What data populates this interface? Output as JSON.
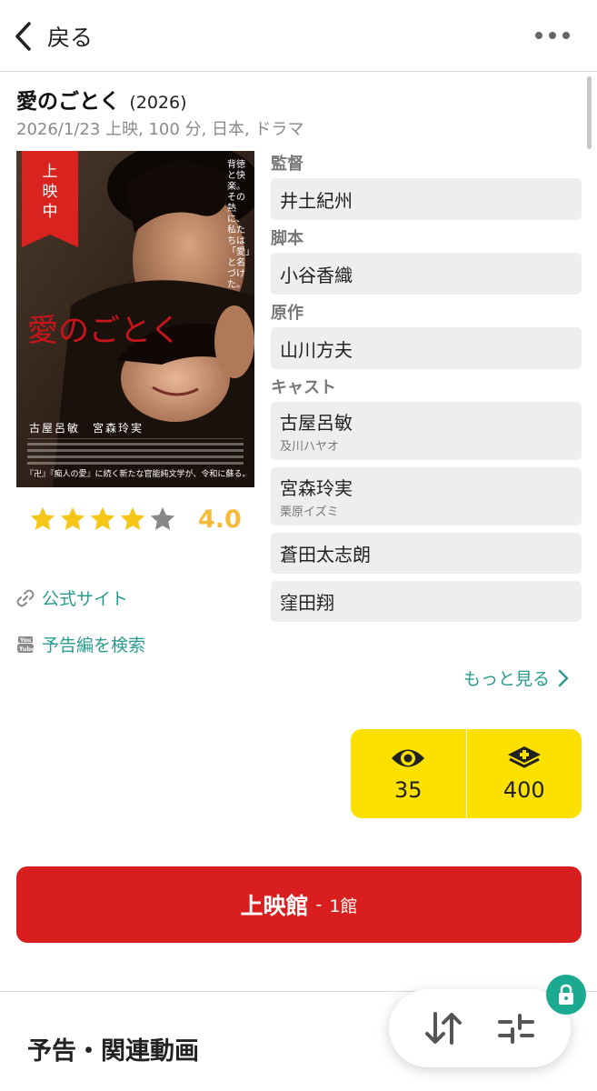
{
  "header": {
    "back_label": "戻る"
  },
  "movie": {
    "title": "愛のごとく",
    "year": "(2026)",
    "meta": "2026/1/23 上映, 100 分, 日本, ドラマ"
  },
  "poster": {
    "badge_line1": "上",
    "badge_line2": "映",
    "badge_line3": "中",
    "title": "愛のごとく",
    "tagline": "背徳と快楽。その熱に、私たちは「愛」と名づけた。",
    "cast": "古屋呂敏　宮森玲実",
    "copy": "『卍』『痴人の愛』に続く新たな官能純文学が、令和に蘇る。"
  },
  "rating": {
    "value": "4.0",
    "stars": 4,
    "max": 5,
    "color_filled": "#f5c518",
    "color_empty": "#888888"
  },
  "links": {
    "official": "公式サイト",
    "trailer": "予告編を検索"
  },
  "credits": {
    "director_label": "監督",
    "director": "井土紀州",
    "writer_label": "脚本",
    "writer": "小谷香織",
    "original_label": "原作",
    "original": "山川方夫",
    "cast_label": "キャスト",
    "cast": [
      {
        "name": "古屋呂敏",
        "role": "及川ハヤオ"
      },
      {
        "name": "宮森玲実",
        "role": "栗原イズミ"
      },
      {
        "name": "蒼田太志朗",
        "role": ""
      },
      {
        "name": "窪田翔",
        "role": ""
      }
    ],
    "more": "もっと見る"
  },
  "stats": {
    "watched": "35",
    "want": "400",
    "color": "#fbe000"
  },
  "theaters": {
    "label": "上映館",
    "separator": "-",
    "count": "1館",
    "color": "#d81e1e"
  },
  "section": {
    "title": "予告・関連動画"
  },
  "icons": {
    "back": "chevron-left-icon",
    "more": "more-dots-icon",
    "link": "link-icon",
    "youtube": "youtube-icon",
    "eye": "eye-icon",
    "add": "add-stack-icon",
    "sort": "sort-icon",
    "filter": "filter-icon",
    "lock": "lock-icon"
  },
  "accent": "#2a9c8f"
}
